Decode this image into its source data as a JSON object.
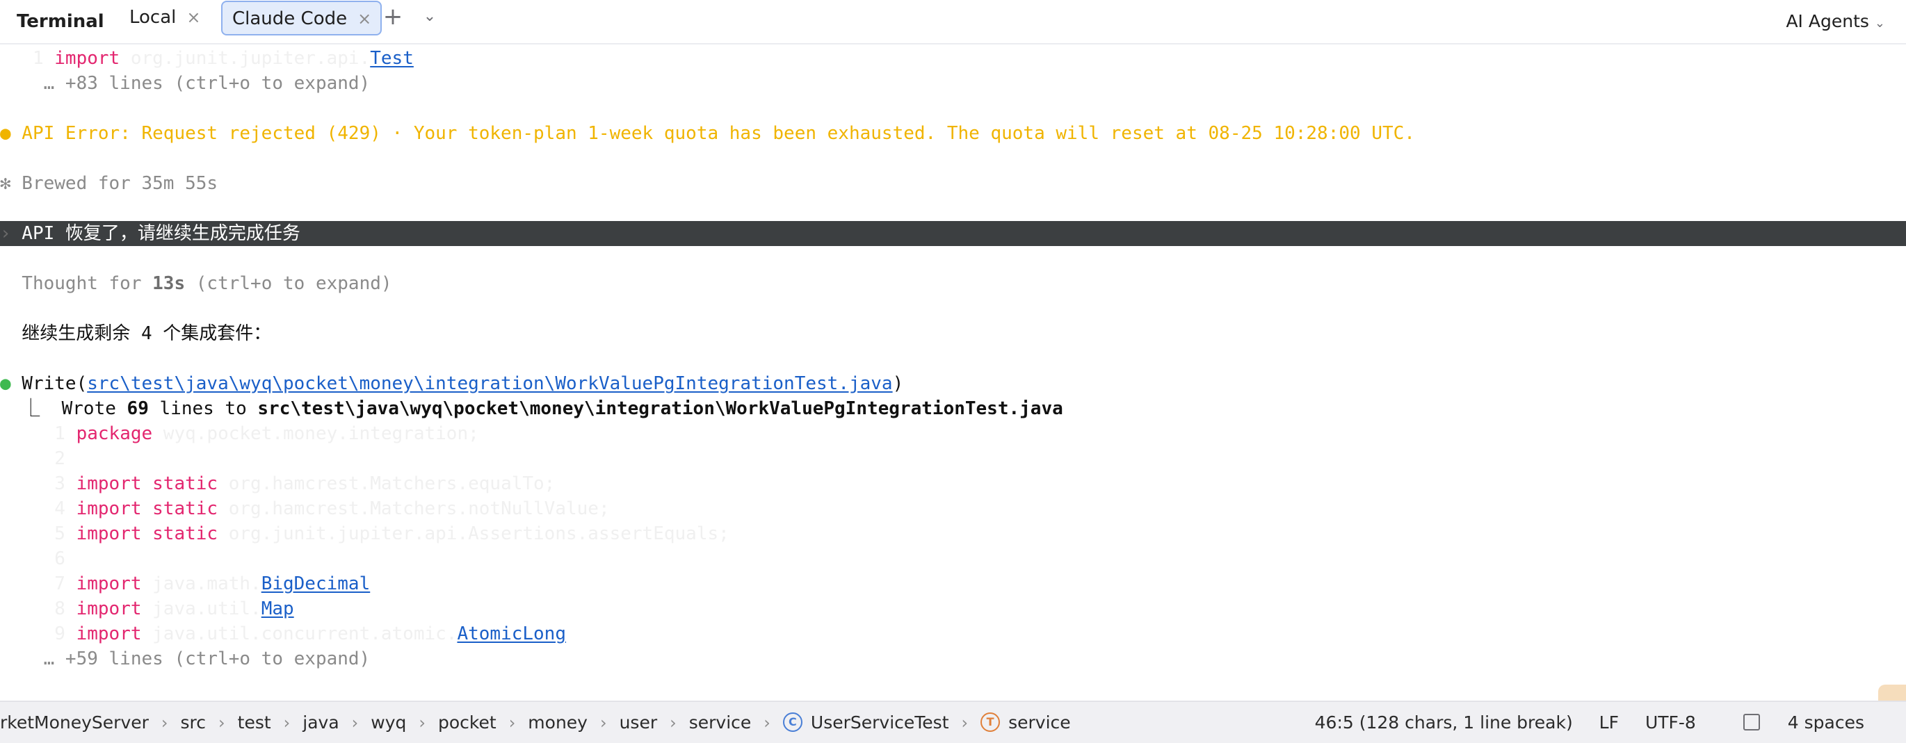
{
  "tabbar": {
    "title": "Terminal",
    "tabs": [
      {
        "label": "Local",
        "close": "×"
      },
      {
        "label": "Claude Code",
        "close": "×"
      }
    ],
    "plus": "+",
    "chevron": "⌄",
    "agents_label": "AI Agents",
    "agents_caret": "⌄"
  },
  "terminal": {
    "l1": {
      "ghost": "   1 ",
      "kw": "import",
      "ghost2": " org.junit.jupiter.api.",
      "link": "Test"
    },
    "l2": "    … +83 lines (ctrl+o to expand)",
    "l3": {
      "bullet": "●",
      "text": " API Error: Request rejected (429) · Your token-plan 1-week quota has been exhausted. The quota will reset at 08-25 10:28:00 UTC."
    },
    "l4": "✻ Brewed for 35m 55s",
    "l5": {
      "chev": "›",
      "text": " API 恢复了，请继续生成完成任务"
    },
    "l6": {
      "a": "  Thought for ",
      "b": "13s",
      "c": " (ctrl+o to expand)"
    },
    "l7": "  继续生成剩余 4 个集成套件：",
    "l8": {
      "bullet": "●",
      "a": " Write(",
      "link": "src\\test\\java\\wyq\\pocket\\money\\integration\\WorkValuePgIntegrationTest.java",
      "b": ")"
    },
    "l9": {
      "a": "  ⎿  Wrote ",
      "n": "69",
      "b": " lines to ",
      "path": "src\\test\\java\\wyq\\pocket\\money\\integration\\WorkValuePgIntegrationTest.java"
    },
    "code": [
      {
        "ghost": "     1 ",
        "kw": "package",
        "ghost2": " wyq.pocket.money.integration;",
        "link": ""
      },
      {
        "ghost": "     2",
        "kw": "",
        "ghost2": "",
        "link": ""
      },
      {
        "ghost": "     3 ",
        "kw": "import static",
        "ghost2": " org.hamcrest.Matchers.equalTo;",
        "link": ""
      },
      {
        "ghost": "     4 ",
        "kw": "import static",
        "ghost2": " org.hamcrest.Matchers.notNullValue;",
        "link": ""
      },
      {
        "ghost": "     5 ",
        "kw": "import static",
        "ghost2": " org.junit.jupiter.api.Assertions.assertEquals;",
        "link": ""
      },
      {
        "ghost": "     6",
        "kw": "",
        "ghost2": "",
        "link": ""
      },
      {
        "ghost": "     7 ",
        "kw": "import",
        "ghost2": " java.math.",
        "link": "BigDecimal"
      },
      {
        "ghost": "     8 ",
        "kw": "import",
        "ghost2": " java.util.",
        "link": "Map"
      },
      {
        "ghost": "     9 ",
        "kw": "import",
        "ghost2": " java.util.concurrent.atomic.",
        "link": "AtomicLong"
      }
    ],
    "l_last": "    … +59 lines (ctrl+o to expand)"
  },
  "status": {
    "breadcrumb": [
      "rketMoneyServer",
      "src",
      "test",
      "java",
      "wyq",
      "pocket",
      "money",
      "user",
      "service",
      "UserServiceTest",
      "service"
    ],
    "sep": "›",
    "class_icon_letter": "C",
    "pkg_icon_letter": "T",
    "position": "46:5 (128 chars, 1 line break)",
    "line_sep": "LF",
    "encoding": "UTF-8",
    "indent": "4 spaces"
  },
  "colors": {
    "keyword": "#e3266f",
    "link": "#1a5fc8",
    "warning": "#f0b400",
    "success": "#3fb950",
    "prompt_bg": "#3c3f41",
    "active_tab_bg": "#e3ecfb"
  }
}
